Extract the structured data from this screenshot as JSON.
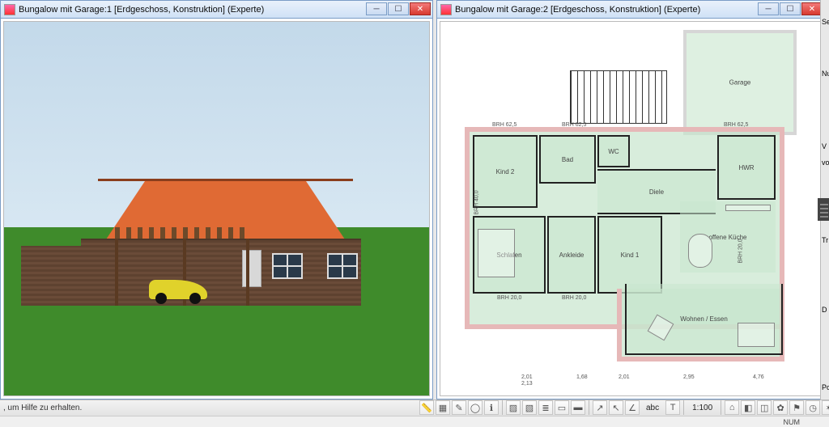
{
  "windows": [
    {
      "title": "Bungalow mit Garage:1 [Erdgeschoss, Konstruktion] (Experte)",
      "type": "3d"
    },
    {
      "title": "Bungalow mit Garage:2 [Erdgeschoss, Konstruktion] (Experte)",
      "type": "2d"
    }
  ],
  "rooms": {
    "kind2": "Kind 2",
    "bad": "Bad",
    "wc": "WC",
    "hwr": "HWR",
    "diele": "Diele",
    "schlafen": "Schlafen",
    "ankleide": "Ankleide",
    "kind1": "Kind 1",
    "offene_kueche": "offene Küche",
    "wohnen_essen": "Wohnen / Essen",
    "garage": "Garage"
  },
  "dimensions": {
    "brh_top_1": "BRH 62,5",
    "brh_top_2": "BRH 62,5",
    "brh_top_3": "BRH 62,5",
    "brh_bottom_1": "BRH 20,0",
    "brh_bottom_2": "BRH 20,0",
    "brh_bottom_3": "BRH 20,0",
    "brh_side": "BRH 40,0",
    "dim_row_b1": "2,01",
    "dim_row_b2": "2,13",
    "dim_row_b3": "1,68",
    "dim_row_b4": "2,01",
    "dim_row_b5": "2,95",
    "dim_row_b6": "4,76",
    "dim_row_b7": "2,13"
  },
  "statusbar": {
    "help": ", um Hilfe zu erhalten.",
    "scale": "1:100",
    "abc": "abc",
    "num": "NUM"
  },
  "right_labels": {
    "l1": "Se",
    "l2": "Nu",
    "l3": "V",
    "l4": "vo",
    "l5": "Tr",
    "l6": "D",
    "l7": "Po"
  },
  "toolbar_icons": [
    "ruler-icon",
    "grid-icon",
    "pencil-icon",
    "circle-icon",
    "info-icon",
    "hatch-icon",
    "hatch2-icon",
    "layers-icon",
    "rect-icon",
    "rect2-icon",
    "arrow-icon",
    "cursor-icon",
    "angle-icon",
    "text-icon",
    "roof-icon",
    "cube-icon",
    "plot-icon",
    "plant-icon",
    "flag-icon",
    "gauge-icon",
    "star-icon",
    "star2-icon"
  ]
}
